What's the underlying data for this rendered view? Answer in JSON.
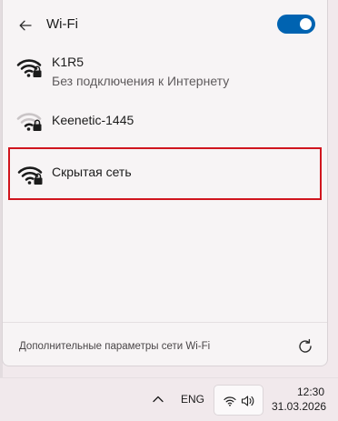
{
  "header": {
    "title": "Wi-Fi",
    "wifi_toggle_on": true,
    "accent_color": "#0063b1"
  },
  "networks": [
    {
      "name": "K1R5",
      "status": "Без подключения к Интернету",
      "icon": "wifi-secured-icon",
      "signal": "full"
    },
    {
      "name": "Keenetic-1445",
      "icon": "wifi-secured-icon",
      "signal": "weak"
    },
    {
      "name": "Скрытая сеть",
      "icon": "wifi-secured-icon",
      "signal": "full",
      "highlight_color": "#d0151e"
    }
  ],
  "footer": {
    "more_settings_label": "Дополнительные параметры сети Wi-Fi",
    "refresh_icon": "refresh-icon"
  },
  "taskbar": {
    "chevron_icon": "chevron-up-icon",
    "language": "ENG",
    "wifi_icon": "wifi-icon",
    "volume_icon": "volume-icon",
    "time": "12:30",
    "date": "31.03.2026"
  }
}
